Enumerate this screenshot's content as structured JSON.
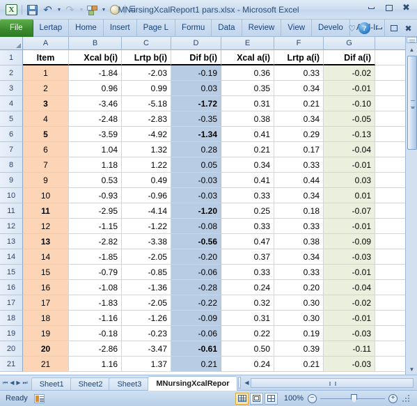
{
  "window": {
    "title": "MNursingXcalReport1 pars.xlsx - Microsoft Excel",
    "minimize_label": "–",
    "restore_label": "❐",
    "close_label": "✕"
  },
  "quick_access": {
    "logo_label": "X",
    "items": [
      {
        "name": "save-icon",
        "label": ""
      },
      {
        "name": "undo-icon",
        "label": "↶"
      },
      {
        "name": "redo-icon",
        "label": "↷"
      },
      {
        "name": "arrange-icon",
        "label": ""
      },
      {
        "name": "circle-icon",
        "label": ""
      }
    ],
    "customize_label": "☰"
  },
  "ribbon": {
    "tabs": [
      {
        "label": "File",
        "active": true
      },
      {
        "label": "Lertap",
        "active": false
      },
      {
        "label": "Home",
        "active": false
      },
      {
        "label": "Insert",
        "active": false
      },
      {
        "label": "Page L",
        "active": false
      },
      {
        "label": "Formu",
        "active": false
      },
      {
        "label": "Data",
        "active": false
      },
      {
        "label": "Review",
        "active": false
      },
      {
        "label": "View",
        "active": false
      },
      {
        "label": "Develo",
        "active": false
      },
      {
        "label": "Add-Ir",
        "active": false
      }
    ],
    "help_label": "?",
    "collapse_label": "♡",
    "doc_minimize_label": "–",
    "doc_restore_label": "❐",
    "doc_close_label": "✕"
  },
  "grid": {
    "column_letters": [
      "A",
      "B",
      "C",
      "D",
      "E",
      "F",
      "G"
    ],
    "headers": [
      "Item",
      "Xcal b(i)",
      "Lrtp b(i)",
      "Dif b(i)",
      "Xcal a(i)",
      "Lrtp a(i)",
      "Dif a(i)"
    ],
    "header_row_number": "1",
    "accent_colors": {
      "item_column": "#FBD5B5",
      "dif_b_column": "#B8CCE4",
      "dif_a_column": "#EAEFDE"
    },
    "rows": [
      {
        "row": "2",
        "item": "1",
        "xcal_b": "-1.84",
        "lrtp_b": "-2.03",
        "dif_b": "-0.19",
        "xcal_a": "0.36",
        "lrtp_a": "0.33",
        "dif_a": "-0.02",
        "bold": false
      },
      {
        "row": "3",
        "item": "2",
        "xcal_b": "0.96",
        "lrtp_b": "0.99",
        "dif_b": "0.03",
        "xcal_a": "0.35",
        "lrtp_a": "0.34",
        "dif_a": "-0.01",
        "bold": false
      },
      {
        "row": "4",
        "item": "3",
        "xcal_b": "-3.46",
        "lrtp_b": "-5.18",
        "dif_b": "-1.72",
        "xcal_a": "0.31",
        "lrtp_a": "0.21",
        "dif_a": "-0.10",
        "bold": true
      },
      {
        "row": "5",
        "item": "4",
        "xcal_b": "-2.48",
        "lrtp_b": "-2.83",
        "dif_b": "-0.35",
        "xcal_a": "0.38",
        "lrtp_a": "0.34",
        "dif_a": "-0.05",
        "bold": false
      },
      {
        "row": "6",
        "item": "5",
        "xcal_b": "-3.59",
        "lrtp_b": "-4.92",
        "dif_b": "-1.34",
        "xcal_a": "0.41",
        "lrtp_a": "0.29",
        "dif_a": "-0.13",
        "bold": true
      },
      {
        "row": "7",
        "item": "6",
        "xcal_b": "1.04",
        "lrtp_b": "1.32",
        "dif_b": "0.28",
        "xcal_a": "0.21",
        "lrtp_a": "0.17",
        "dif_a": "-0.04",
        "bold": false
      },
      {
        "row": "8",
        "item": "7",
        "xcal_b": "1.18",
        "lrtp_b": "1.22",
        "dif_b": "0.05",
        "xcal_a": "0.34",
        "lrtp_a": "0.33",
        "dif_a": "-0.01",
        "bold": false
      },
      {
        "row": "9",
        "item": "9",
        "xcal_b": "0.53",
        "lrtp_b": "0.49",
        "dif_b": "-0.03",
        "xcal_a": "0.41",
        "lrtp_a": "0.44",
        "dif_a": "0.03",
        "bold": false
      },
      {
        "row": "10",
        "item": "10",
        "xcal_b": "-0.93",
        "lrtp_b": "-0.96",
        "dif_b": "-0.03",
        "xcal_a": "0.33",
        "lrtp_a": "0.34",
        "dif_a": "0.01",
        "bold": false
      },
      {
        "row": "11",
        "item": "11",
        "xcal_b": "-2.95",
        "lrtp_b": "-4.14",
        "dif_b": "-1.20",
        "xcal_a": "0.25",
        "lrtp_a": "0.18",
        "dif_a": "-0.07",
        "bold": true
      },
      {
        "row": "12",
        "item": "12",
        "xcal_b": "-1.15",
        "lrtp_b": "-1.22",
        "dif_b": "-0.08",
        "xcal_a": "0.33",
        "lrtp_a": "0.33",
        "dif_a": "-0.01",
        "bold": false
      },
      {
        "row": "13",
        "item": "13",
        "xcal_b": "-2.82",
        "lrtp_b": "-3.38",
        "dif_b": "-0.56",
        "xcal_a": "0.47",
        "lrtp_a": "0.38",
        "dif_a": "-0.09",
        "bold": true
      },
      {
        "row": "14",
        "item": "14",
        "xcal_b": "-1.85",
        "lrtp_b": "-2.05",
        "dif_b": "-0.20",
        "xcal_a": "0.37",
        "lrtp_a": "0.34",
        "dif_a": "-0.03",
        "bold": false
      },
      {
        "row": "15",
        "item": "15",
        "xcal_b": "-0.79",
        "lrtp_b": "-0.85",
        "dif_b": "-0.06",
        "xcal_a": "0.33",
        "lrtp_a": "0.33",
        "dif_a": "-0.01",
        "bold": false
      },
      {
        "row": "16",
        "item": "16",
        "xcal_b": "-1.08",
        "lrtp_b": "-1.36",
        "dif_b": "-0.28",
        "xcal_a": "0.24",
        "lrtp_a": "0.20",
        "dif_a": "-0.04",
        "bold": false
      },
      {
        "row": "17",
        "item": "17",
        "xcal_b": "-1.83",
        "lrtp_b": "-2.05",
        "dif_b": "-0.22",
        "xcal_a": "0.32",
        "lrtp_a": "0.30",
        "dif_a": "-0.02",
        "bold": false
      },
      {
        "row": "18",
        "item": "18",
        "xcal_b": "-1.16",
        "lrtp_b": "-1.26",
        "dif_b": "-0.09",
        "xcal_a": "0.31",
        "lrtp_a": "0.30",
        "dif_a": "-0.01",
        "bold": false
      },
      {
        "row": "19",
        "item": "19",
        "xcal_b": "-0.18",
        "lrtp_b": "-0.23",
        "dif_b": "-0.06",
        "xcal_a": "0.22",
        "lrtp_a": "0.19",
        "dif_a": "-0.03",
        "bold": false
      },
      {
        "row": "20",
        "item": "20",
        "xcal_b": "-2.86",
        "lrtp_b": "-3.47",
        "dif_b": "-0.61",
        "xcal_a": "0.50",
        "lrtp_a": "0.39",
        "dif_a": "-0.11",
        "bold": true
      },
      {
        "row": "21",
        "item": "21",
        "xcal_b": "1.16",
        "lrtp_b": "1.37",
        "dif_b": "0.21",
        "xcal_a": "0.24",
        "lrtp_a": "0.21",
        "dif_a": "-0.03",
        "bold": false
      }
    ]
  },
  "sheet_tabs": {
    "nav_first": "⏮",
    "nav_prev": "◀",
    "nav_next": "▶",
    "nav_last": "⏭",
    "tabs": [
      {
        "label": "Sheet1",
        "active": false
      },
      {
        "label": "Sheet2",
        "active": false
      },
      {
        "label": "Sheet3",
        "active": false
      },
      {
        "label": "MNursingXcalRepor",
        "active": true
      }
    ],
    "hs_left": "◀",
    "hs_right": "▶"
  },
  "status": {
    "ready_label": "Ready",
    "zoom_label": "100%",
    "zoom_out_label": "−",
    "zoom_in_label": "+",
    "views": [
      {
        "name": "normal-view-button",
        "selected": true
      },
      {
        "name": "page-layout-view-button",
        "selected": false
      },
      {
        "name": "page-break-view-button",
        "selected": false
      }
    ]
  }
}
